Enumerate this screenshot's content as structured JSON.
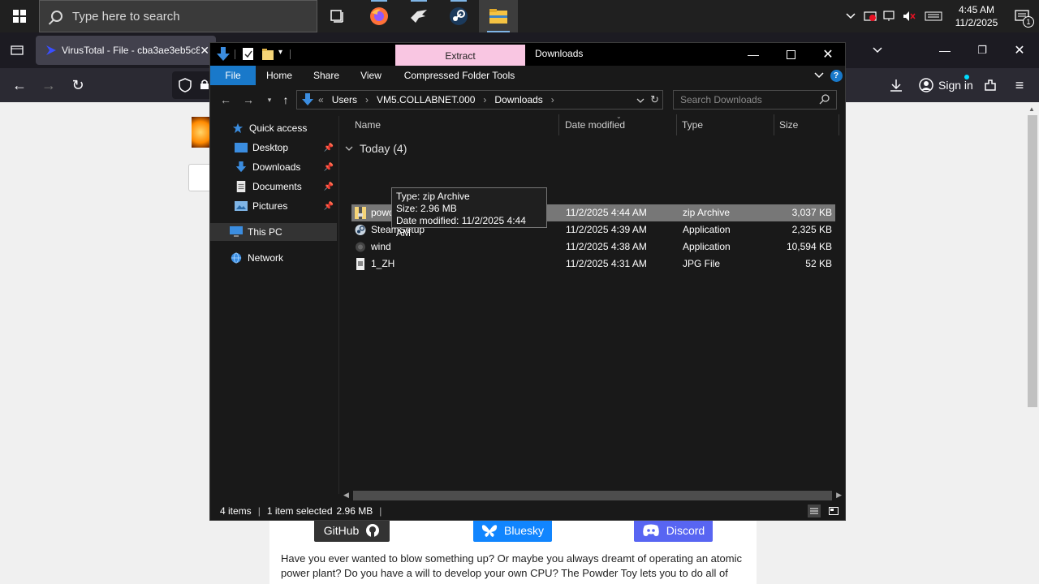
{
  "taskbar": {
    "search_placeholder": "Type here to search",
    "clock_time": "4:45 AM",
    "clock_date": "11/2/2025",
    "notification_count": "1",
    "apps": [
      "task-view",
      "firefox",
      "app-eagle",
      "steam",
      "file-explorer"
    ]
  },
  "browser": {
    "tab_title": "VirusTotal - File - cba3ae3eb5c8",
    "sign_in_label": "Sign in",
    "social": {
      "github": "GitHub",
      "bluesky": "Bluesky",
      "discord": "Discord"
    },
    "intro_text": "Have you ever wanted to blow something up? Or maybe you always dreamt of operating an atomic power plant? Do you have a will to develop your own CPU? The Powder Toy lets you to do all of"
  },
  "explorer": {
    "title": "Downloads",
    "context_tab": "Extract",
    "ribbon_tabs": {
      "file": "File",
      "home": "Home",
      "share": "Share",
      "view": "View",
      "tools": "Compressed Folder Tools"
    },
    "breadcrumb": {
      "overflow": "«",
      "c1": "Users",
      "c2": "VM5.COLLABNET.000",
      "c3": "Downloads"
    },
    "search_placeholder": "Search Downloads",
    "nav": {
      "quick_access": "Quick access",
      "desktop": "Desktop",
      "downloads": "Downloads",
      "documents": "Documents",
      "pictures": "Pictures",
      "this_pc": "This PC",
      "network": "Network"
    },
    "columns": {
      "name": "Name",
      "date": "Date modified",
      "type": "Type",
      "size": "Size"
    },
    "group_header": "Today (4)",
    "files": [
      {
        "name": "powder",
        "date": "11/2/2025 4:44 AM",
        "type": "zip Archive",
        "size": "3,037 KB"
      },
      {
        "name": "SteamSetup",
        "date": "11/2/2025 4:39 AM",
        "type": "Application",
        "size": "2,325 KB"
      },
      {
        "name": "wind",
        "date": "11/2/2025 4:38 AM",
        "type": "Application",
        "size": "10,594 KB"
      },
      {
        "name": "1_ZH",
        "date": "11/2/2025 4:31 AM",
        "type": "JPG File",
        "size": "52 KB"
      }
    ],
    "tooltip": {
      "line1": "Type: zip Archive",
      "line2": "Size: 2.96 MB",
      "line3": "Date modified: 11/2/2025 4:44 AM"
    },
    "status": {
      "items": "4 items",
      "selected": "1 item selected",
      "selected_size": "2.96 MB"
    }
  },
  "colors": {
    "ribbon_file": "#1979ca",
    "extract_bg": "#f9c6e2",
    "bluesky": "#1185fe",
    "discord": "#5865f2",
    "github": "#333333"
  }
}
